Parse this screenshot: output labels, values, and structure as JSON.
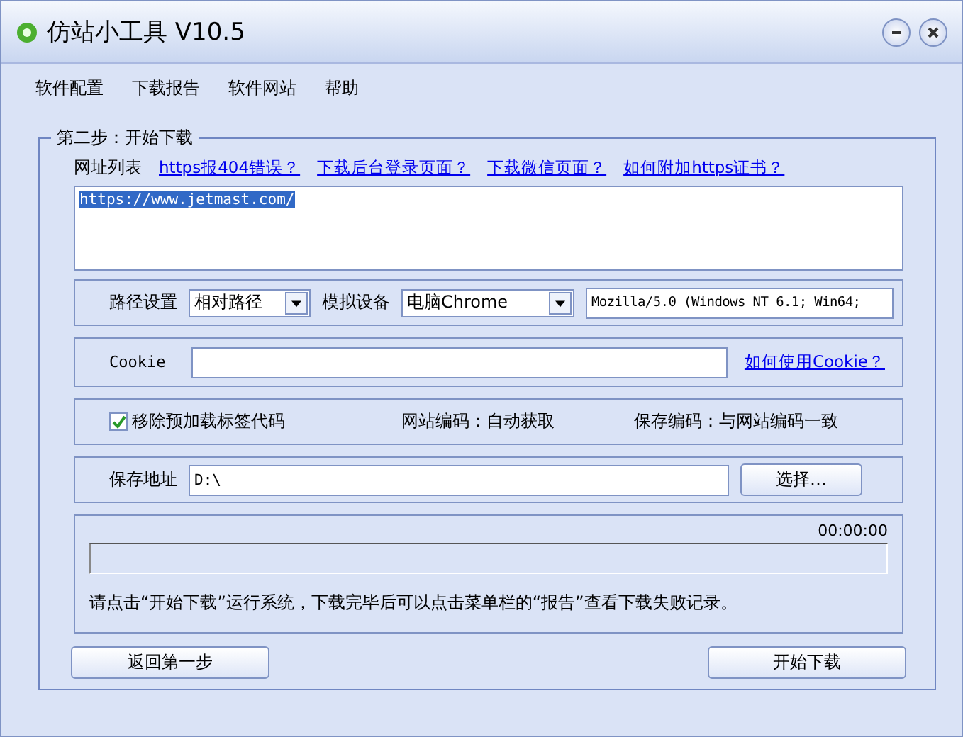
{
  "window": {
    "title": "仿站小工具 V10.5"
  },
  "menu": [
    "软件配置",
    "下载报告",
    "软件网站",
    "帮助"
  ],
  "group": {
    "title": "第二步：开始下载",
    "url_list": {
      "label": "网址列表",
      "links": [
        "https报404错误？",
        "下载后台登录页面？",
        "下载微信页面？",
        "如何附加https证书？"
      ],
      "value": "https://www.jetmast.com/"
    },
    "path": {
      "label": "路径设置",
      "value": "相对路径"
    },
    "device": {
      "label": "模拟设备",
      "value": "电脑Chrome",
      "user_agent": "Mozilla/5.0 (Windows NT 6.1; Win64;"
    },
    "cookie": {
      "label": "Cookie",
      "link": "如何使用Cookie？"
    },
    "options": {
      "remove_preload": {
        "label": "移除预加载标签代码",
        "checked": true
      },
      "site_encoding": "网站编码：自动获取",
      "save_encoding": "保存编码：与网站编码一致"
    },
    "save": {
      "label": "保存地址",
      "value": "D:\\",
      "button": "选择…"
    },
    "progress": {
      "time": "00:00:00",
      "message": "请点击“开始下载”运行系统，下载完毕后可以点击菜单栏的“报告”查看下载失败记录。"
    },
    "buttons": [
      "返回第一步",
      "开始下载"
    ]
  }
}
